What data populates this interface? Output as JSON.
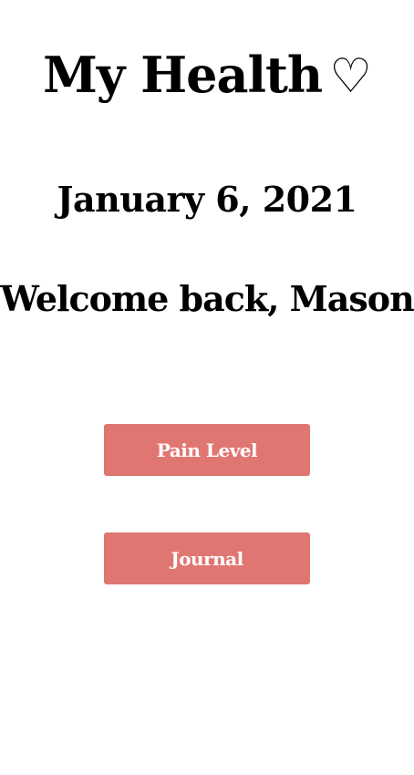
{
  "header": {
    "title": "My Health",
    "heart_glyph": "♡"
  },
  "date_text": "January 6, 2021",
  "welcome_text": "Welcome back, Mason",
  "actions": [
    {
      "label": "Pain Level"
    },
    {
      "label": "Journal"
    }
  ],
  "colors": {
    "button_background": "#e07672",
    "button_text": "#ffffff",
    "text": "#000000",
    "background": "#ffffff"
  }
}
